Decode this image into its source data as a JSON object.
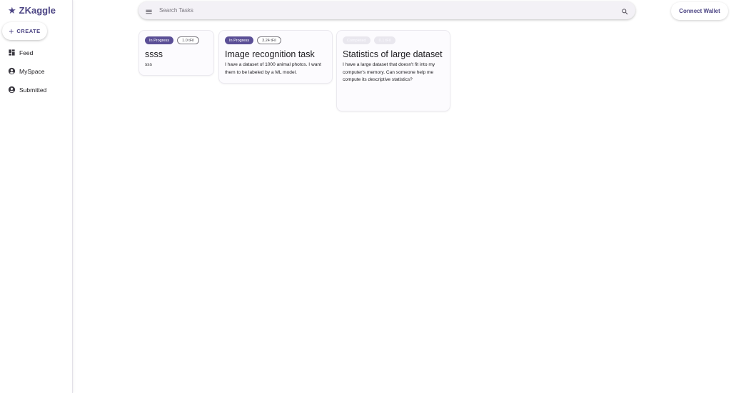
{
  "brand": {
    "name": "ZKaggle",
    "icon": "star-icon",
    "color": "#4c4584"
  },
  "sidebar": {
    "create_label": "CREATE",
    "items": [
      {
        "label": "Feed",
        "icon": "dashboard-icon"
      },
      {
        "label": "MySpace",
        "icon": "account-circle-icon"
      },
      {
        "label": "Submitted",
        "icon": "account-circle-icon"
      }
    ]
  },
  "search": {
    "placeholder": "Search Tasks",
    "value": ""
  },
  "header": {
    "connect_label": "Connect Wallet"
  },
  "tasks": [
    {
      "status": "In Progress",
      "price": "1.0 tFil",
      "title": "ssss",
      "description": "sss"
    },
    {
      "status": "In Progress",
      "price": "3.24 tFil",
      "title": "Image recognition task",
      "description": "I have a dataset of 1000 animal photos. I want them to be labeled by a ML model."
    },
    {
      "status": "Completed",
      "price": "0.1 tFil",
      "title": "Statistics of large dataset",
      "description": "I have a large dataset that doesn't fit into my computer's memory. Can someone help me compute its descriptive statistics?"
    }
  ]
}
